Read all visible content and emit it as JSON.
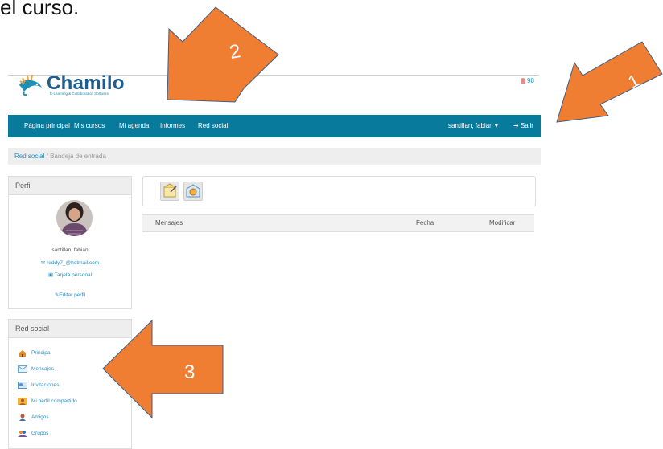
{
  "caption_fragment": "el curso.",
  "logo": {
    "name": "Chamilo",
    "tagline": "E-Learning & Collaboration Software"
  },
  "header": {
    "user_count": "98"
  },
  "nav": {
    "items": [
      "Página principal",
      "Mis cursos",
      "Mi agenda",
      "Informes",
      "Red social"
    ],
    "user_menu": "santillan, fabian",
    "logout": "Salir"
  },
  "breadcrumb": {
    "link": "Red social",
    "separator": "/",
    "current": "Bandeja de entrada"
  },
  "profile": {
    "title": "Perfil",
    "name": "santillan, fabian",
    "email": "reddy7_@hotmail.com",
    "card": "Tarjeta personal",
    "edit": "Editar perfil"
  },
  "social": {
    "title": "Red social",
    "items": [
      "Principal",
      "Mensajes",
      "Invitaciones",
      "Mi perfil compartido",
      "Amigos",
      "Grupos"
    ]
  },
  "table": {
    "headers": [
      "Mensajes",
      "Fecha",
      "Modificar"
    ]
  },
  "arrows": [
    "1",
    "2",
    "3"
  ],
  "colors": {
    "navbar": "#087a9c",
    "link": "#2a8fbd",
    "arrow": "#ef7d32"
  }
}
